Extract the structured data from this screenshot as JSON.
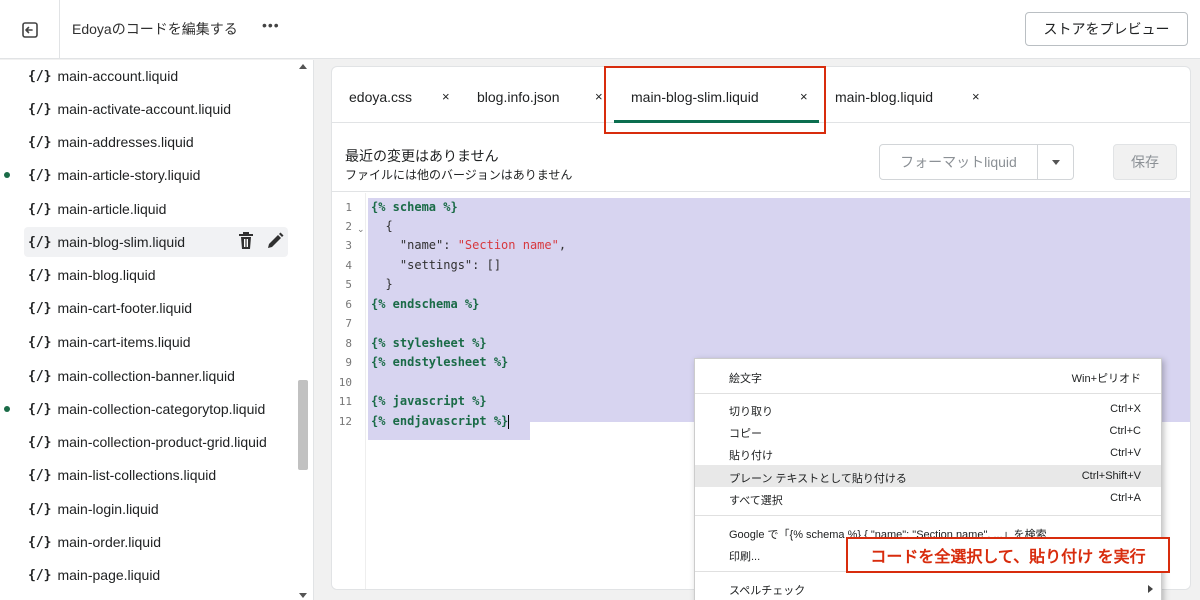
{
  "header": {
    "title": "Edoyaのコードを編集する",
    "more_label": "•••",
    "preview_label": "ストアをプレビュー"
  },
  "sidebar": {
    "files": [
      {
        "label": "main-account.liquid",
        "modified": false
      },
      {
        "label": "main-activate-account.liquid",
        "modified": false
      },
      {
        "label": "main-addresses.liquid",
        "modified": false
      },
      {
        "label": "main-article-story.liquid",
        "modified": true
      },
      {
        "label": "main-article.liquid",
        "modified": false
      },
      {
        "label": "main-blog-slim.liquid",
        "modified": false,
        "active": true
      },
      {
        "label": "main-blog.liquid",
        "modified": false
      },
      {
        "label": "main-cart-footer.liquid",
        "modified": false
      },
      {
        "label": "main-cart-items.liquid",
        "modified": false
      },
      {
        "label": "main-collection-banner.liquid",
        "modified": false
      },
      {
        "label": "main-collection-categorytop.liquid",
        "modified": true
      },
      {
        "label": "main-collection-product-grid.liquid",
        "modified": false
      },
      {
        "label": "main-list-collections.liquid",
        "modified": false
      },
      {
        "label": "main-login.liquid",
        "modified": false
      },
      {
        "label": "main-order.liquid",
        "modified": false
      },
      {
        "label": "main-page.liquid",
        "modified": false
      }
    ],
    "file_icon": "{/}"
  },
  "tabs": [
    {
      "label": "edoya.css",
      "close": "×"
    },
    {
      "label": "blog.info.json",
      "close": "×"
    },
    {
      "label": "main-blog-slim.liquid",
      "close": "×",
      "active": true
    },
    {
      "label": "main-blog.liquid",
      "close": "×"
    }
  ],
  "info": {
    "title": "最近の変更はありません",
    "subtitle": "ファイルには他のバージョンはありません",
    "format_label": "フォーマットliquid",
    "save_label": "保存"
  },
  "code": {
    "line_numbers": [
      "1",
      "2",
      "3",
      "4",
      "5",
      "6",
      "7",
      "8",
      "9",
      "10",
      "11",
      "12"
    ],
    "lines": [
      "{% schema %}",
      "  {",
      "    \"name\": \"Section name\",",
      "    \"settings\": []",
      "  }",
      "{% endschema %}",
      "",
      "{% stylesheet %}",
      "{% endstylesheet %}",
      "",
      "{% javascript %}",
      "{% endjavascript %}"
    ]
  },
  "context_menu": {
    "emoji": {
      "label": "絵文字",
      "shortcut": "Win+ピリオド"
    },
    "cut": {
      "label": "切り取り",
      "shortcut": "Ctrl+X"
    },
    "copy": {
      "label": "コピー",
      "shortcut": "Ctrl+C"
    },
    "paste": {
      "label": "貼り付け",
      "shortcut": "Ctrl+V"
    },
    "paste_plain": {
      "label": "プレーン テキストとして貼り付ける",
      "shortcut": "Ctrl+Shift+V"
    },
    "select_all": {
      "label": "すべて選択",
      "shortcut": "Ctrl+A"
    },
    "google_search": {
      "label": "Google で「{% schema %} {    \"name\": \"Section name\", ...」を検索"
    },
    "print": {
      "label": "印刷..."
    },
    "spellcheck": {
      "label": "スペルチェック"
    }
  },
  "annotation": {
    "text": "コードを全選択して、貼り付け を実行"
  },
  "colors": {
    "accent": "#0b6e4f",
    "highlight": "#d82c0d",
    "selection": "#d7d4f0"
  }
}
